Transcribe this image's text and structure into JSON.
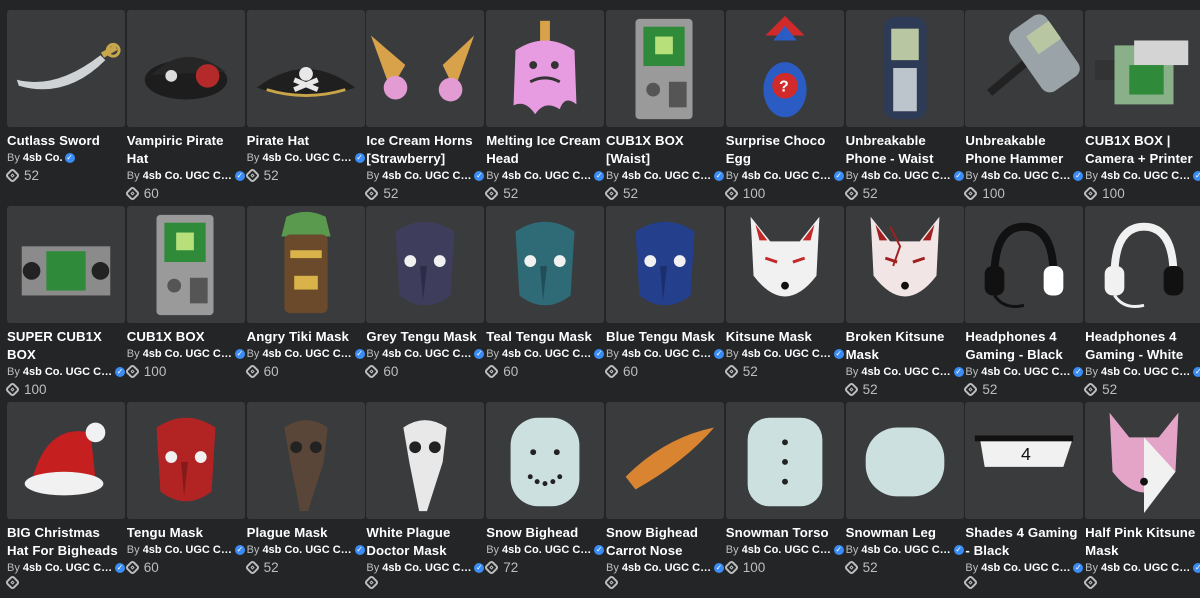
{
  "items": [
    {
      "name": "Cutlass Sword",
      "by": "By",
      "creator": "4sb Co.",
      "price": "52",
      "icon": "cutlass-sword"
    },
    {
      "name": "Vampiric Pirate Hat",
      "by": "By",
      "creator": "4sb Co. UGC Clo...",
      "price": "60",
      "icon": "vampiric-pirate-hat"
    },
    {
      "name": "Pirate Hat",
      "by": "By",
      "creator": "4sb Co. UGC Clo...",
      "price": "52",
      "icon": "pirate-hat"
    },
    {
      "name": "Ice Cream Horns [Strawberry]",
      "by": "By",
      "creator": "4sb Co. UGC Clo...",
      "price": "52",
      "icon": "ice-cream-horns"
    },
    {
      "name": "Melting Ice Cream Head",
      "by": "By",
      "creator": "4sb Co. UGC Clo...",
      "price": "52",
      "icon": "melting-ice-cream-head"
    },
    {
      "name": "CUB1X BOX [Waist]",
      "by": "By",
      "creator": "4sb Co. UGC Clo...",
      "price": "52",
      "icon": "cub1x-box-waist"
    },
    {
      "name": "Surprise Choco Egg",
      "by": "By",
      "creator": "4sb Co. UGC Clo...",
      "price": "100",
      "icon": "surprise-choco-egg"
    },
    {
      "name": "Unbreakable Phone - Waist",
      "by": "By",
      "creator": "4sb Co. UGC Clo...",
      "price": "52",
      "icon": "unbreakable-phone"
    },
    {
      "name": "Unbreakable Phone Hammer",
      "by": "By",
      "creator": "4sb Co. UGC Clo...",
      "price": "100",
      "icon": "phone-hammer"
    },
    {
      "name": "CUB1X BOX | Camera + Printer",
      "by": "By",
      "creator": "4sb Co. UGC Clo...",
      "price": "100",
      "icon": "cub1x-camera-printer"
    },
    {
      "name": "SUPER CUB1X BOX",
      "by": "By",
      "creator": "4sb Co. UGC Clo...",
      "price": "100",
      "icon": "super-cub1x-box"
    },
    {
      "name": "CUB1X BOX",
      "by": "By",
      "creator": "4sb Co. UGC Clo...",
      "price": "100",
      "icon": "cub1x-box"
    },
    {
      "name": "Angry Tiki Mask",
      "by": "By",
      "creator": "4sb Co. UGC Clo...",
      "price": "60",
      "icon": "angry-tiki-mask"
    },
    {
      "name": "Grey Tengu Mask",
      "by": "By",
      "creator": "4sb Co. UGC Clo...",
      "price": "60",
      "icon": "grey-tengu-mask"
    },
    {
      "name": "Teal Tengu Mask",
      "by": "By",
      "creator": "4sb Co. UGC Clo...",
      "price": "60",
      "icon": "teal-tengu-mask"
    },
    {
      "name": "Blue Tengu Mask",
      "by": "By",
      "creator": "4sb Co. UGC Clo...",
      "price": "60",
      "icon": "blue-tengu-mask"
    },
    {
      "name": "Kitsune Mask",
      "by": "By",
      "creator": "4sb Co. UGC Clo...",
      "price": "52",
      "icon": "kitsune-mask"
    },
    {
      "name": "Broken Kitsune Mask",
      "by": "By",
      "creator": "4sb Co. UGC Clo...",
      "price": "52",
      "icon": "broken-kitsune-mask"
    },
    {
      "name": "Headphones 4 Gaming - Black",
      "by": "By",
      "creator": "4sb Co. UGC Clo...",
      "price": "52",
      "icon": "headphones-black"
    },
    {
      "name": "Headphones 4 Gaming - White",
      "by": "By",
      "creator": "4sb Co. UGC Clo...",
      "price": "52",
      "icon": "headphones-white"
    },
    {
      "name": "BIG Christmas Hat For Bigheads",
      "by": "By",
      "creator": "4sb Co. UGC Clo...",
      "price": "",
      "icon": "christmas-hat"
    },
    {
      "name": "Tengu Mask",
      "by": "By",
      "creator": "4sb Co. UGC Clo...",
      "price": "60",
      "icon": "tengu-mask"
    },
    {
      "name": "Plague Mask",
      "by": "By",
      "creator": "4sb Co. UGC Clo...",
      "price": "52",
      "icon": "plague-mask"
    },
    {
      "name": "White Plague Doctor Mask",
      "by": "By",
      "creator": "4sb Co. UGC Clo...",
      "price": "",
      "icon": "white-plague-mask"
    },
    {
      "name": "Snow Bighead",
      "by": "By",
      "creator": "4sb Co. UGC Clo...",
      "price": "72",
      "icon": "snow-bighead"
    },
    {
      "name": "Snow Bighead Carrot Nose",
      "by": "By",
      "creator": "4sb Co. UGC Clo...",
      "price": "",
      "icon": "carrot-nose"
    },
    {
      "name": "Snowman Torso",
      "by": "By",
      "creator": "4sb Co. UGC Clo...",
      "price": "100",
      "icon": "snowman-torso"
    },
    {
      "name": "Snowman Leg",
      "by": "By",
      "creator": "4sb Co. UGC Clo...",
      "price": "52",
      "icon": "snowman-leg"
    },
    {
      "name": "Shades 4 Gaming - Black",
      "by": "By",
      "creator": "4sb Co. UGC Clo...",
      "price": "",
      "icon": "shades-black"
    },
    {
      "name": "Half Pink Kitsune Mask",
      "by": "By",
      "creator": "4sb Co. UGC Clo...",
      "price": "",
      "icon": "half-pink-kitsune"
    }
  ],
  "verified_mark": "✓"
}
